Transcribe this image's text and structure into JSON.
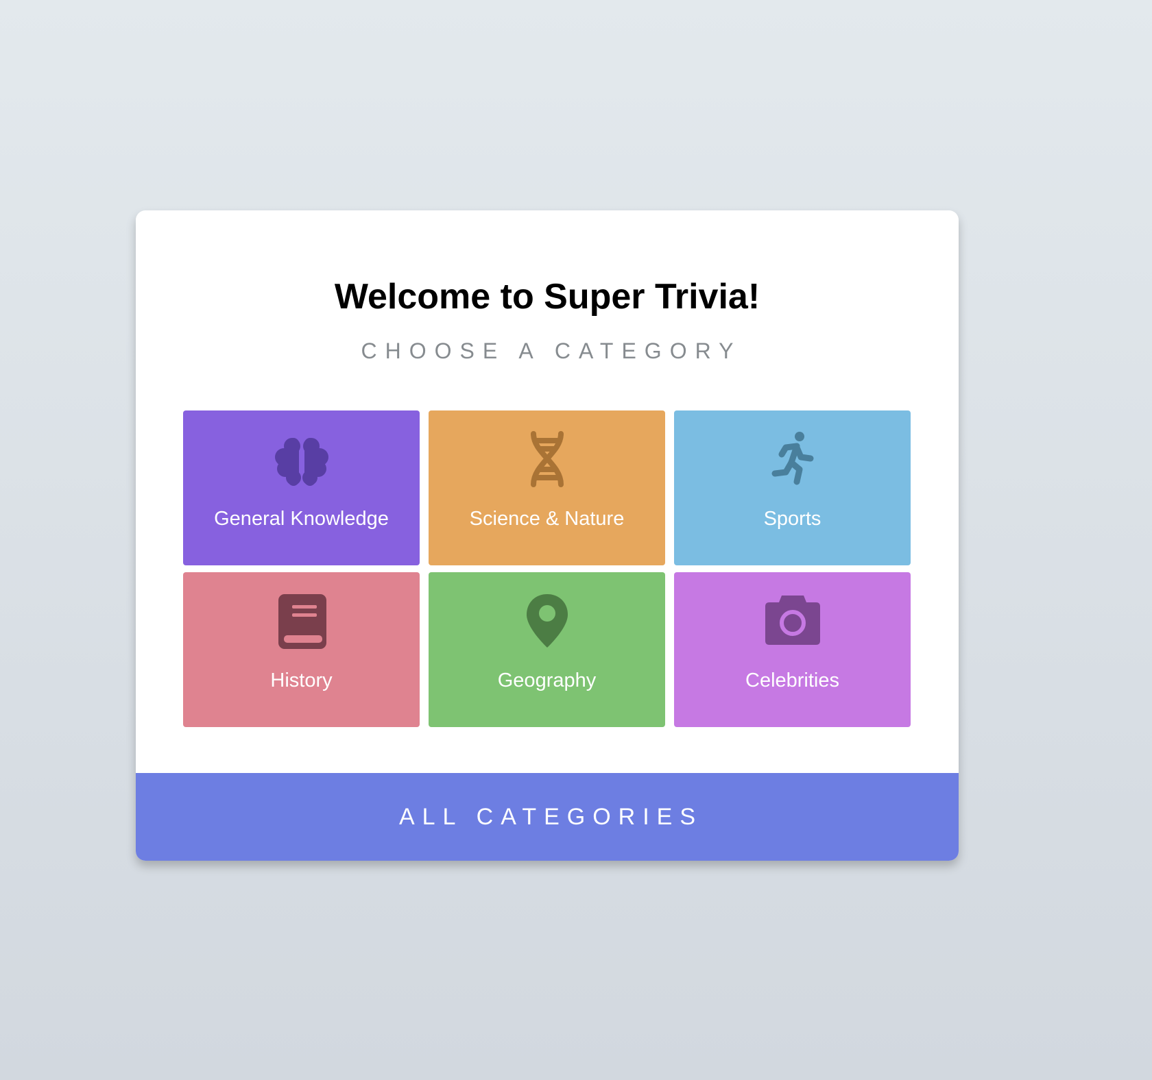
{
  "header": {
    "title": "Welcome to Super Trivia!",
    "subtitle": "CHOOSE A CATEGORY"
  },
  "categories": [
    {
      "label": "General Knowledge",
      "icon": "brain-icon",
      "color": "#8761df",
      "icon_color": "#583ea4"
    },
    {
      "label": "Science & Nature",
      "icon": "dna-icon",
      "color": "#e6a75d",
      "icon_color": "#a97335"
    },
    {
      "label": "Sports",
      "icon": "running-icon",
      "color": "#7bbde2",
      "icon_color": "#497f9c"
    },
    {
      "label": "History",
      "icon": "book-icon",
      "color": "#df8390",
      "icon_color": "#7a3f4c"
    },
    {
      "label": "Geography",
      "icon": "map-pin-icon",
      "color": "#7ec372",
      "icon_color": "#4c7d44"
    },
    {
      "label": "Celebrities",
      "icon": "camera-icon",
      "color": "#c679e3",
      "icon_color": "#7b4690"
    }
  ],
  "footer": {
    "label": "ALL CATEGORIES",
    "color": "#6d7ee2"
  }
}
